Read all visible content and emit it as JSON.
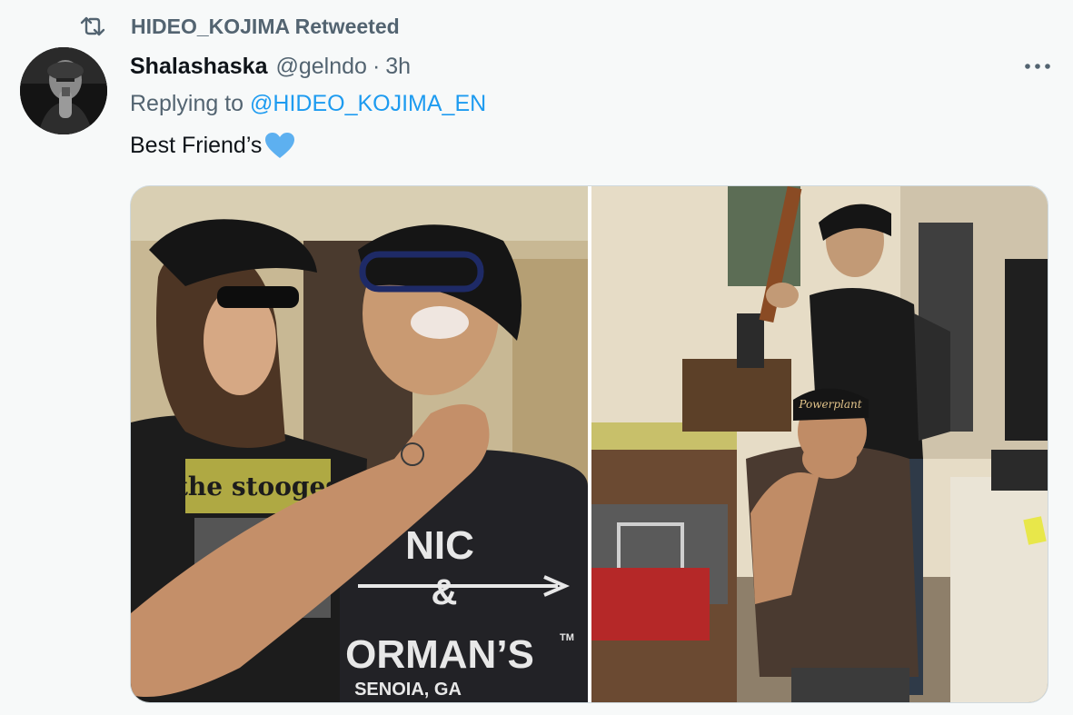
{
  "retweet": {
    "label": "HIDEO_KOJIMA Retweeted",
    "icon": "retweet-icon"
  },
  "author": {
    "display_name": "Shalashaska",
    "handle": "@gelndo",
    "separator": "·",
    "time": "3h"
  },
  "reply": {
    "prefix": "Replying to ",
    "mention": "@HIDEO_KOJIMA_EN"
  },
  "tweet": {
    "text": "Best Friend’s",
    "emoji_icon": "blue-heart-icon"
  },
  "menu": {
    "icon": "more-horizontal-icon"
  },
  "media": {
    "left_photo": {
      "shirt_brand": "the stooges",
      "shirt_text_1": "NIC",
      "shirt_text_2": "&",
      "shirt_text_3": "ORMAN’S",
      "shirt_trademark": "TM",
      "shirt_text_4": "SENOIA, GA"
    },
    "right_photo": {
      "cap_text": "Powerplant"
    }
  },
  "colors": {
    "accent": "#1d9bf0",
    "secondary_text": "#536471",
    "background": "#f7f9f9",
    "heart": "#5db0f0"
  }
}
